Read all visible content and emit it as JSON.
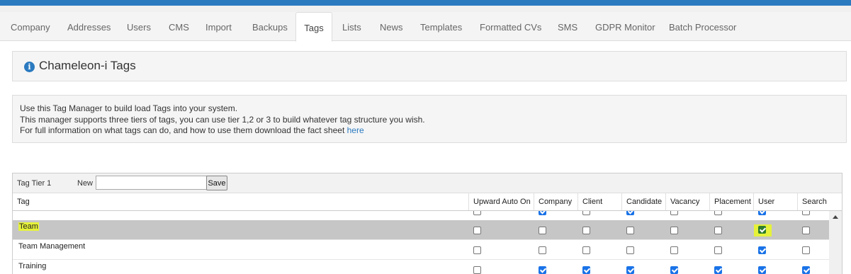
{
  "tabs": [
    "Company",
    "Addresses",
    "Users",
    "CMS",
    "Import",
    "Backups",
    "Tags",
    "Lists",
    "News",
    "Templates",
    "Formatted CVs",
    "SMS",
    "GDPR Monitor",
    "Batch Processor"
  ],
  "active_tab": "Tags",
  "panel": {
    "title": "Chameleon-i Tags",
    "icon": "info-icon"
  },
  "description": {
    "line1": "Use this Tag Manager to build load Tags into your system.",
    "line2": "This manager supports three tiers of tags, you can use tier 1,2 or 3 to build whatever tag structure you wish.",
    "line3": "For full information on what tags can do, and how to use them download the fact sheet",
    "link": "here"
  },
  "toolbar": {
    "tier_label": "Tag Tier 1",
    "new_label": "New",
    "new_value": "",
    "save_label": "Save"
  },
  "columns": [
    "Tag",
    "Upward Auto On",
    "Company",
    "Client",
    "Candidate",
    "Vacancy",
    "Placement",
    "User",
    "Search"
  ],
  "rows": [
    {
      "tag": "",
      "values": [
        false,
        true,
        false,
        true,
        false,
        false,
        true,
        false
      ]
    },
    {
      "tag": "Team",
      "values": [
        false,
        false,
        false,
        false,
        false,
        false,
        true,
        false
      ],
      "selected": true
    },
    {
      "tag": "Team Management",
      "values": [
        false,
        false,
        false,
        false,
        false,
        false,
        true,
        false
      ]
    },
    {
      "tag": "Training",
      "values": [
        false,
        true,
        true,
        true,
        true,
        true,
        true,
        true
      ]
    }
  ],
  "colors": {
    "accent": "#2a7ac0",
    "highlight": "#e6f23a",
    "selected_row": "#c6c6c6"
  }
}
